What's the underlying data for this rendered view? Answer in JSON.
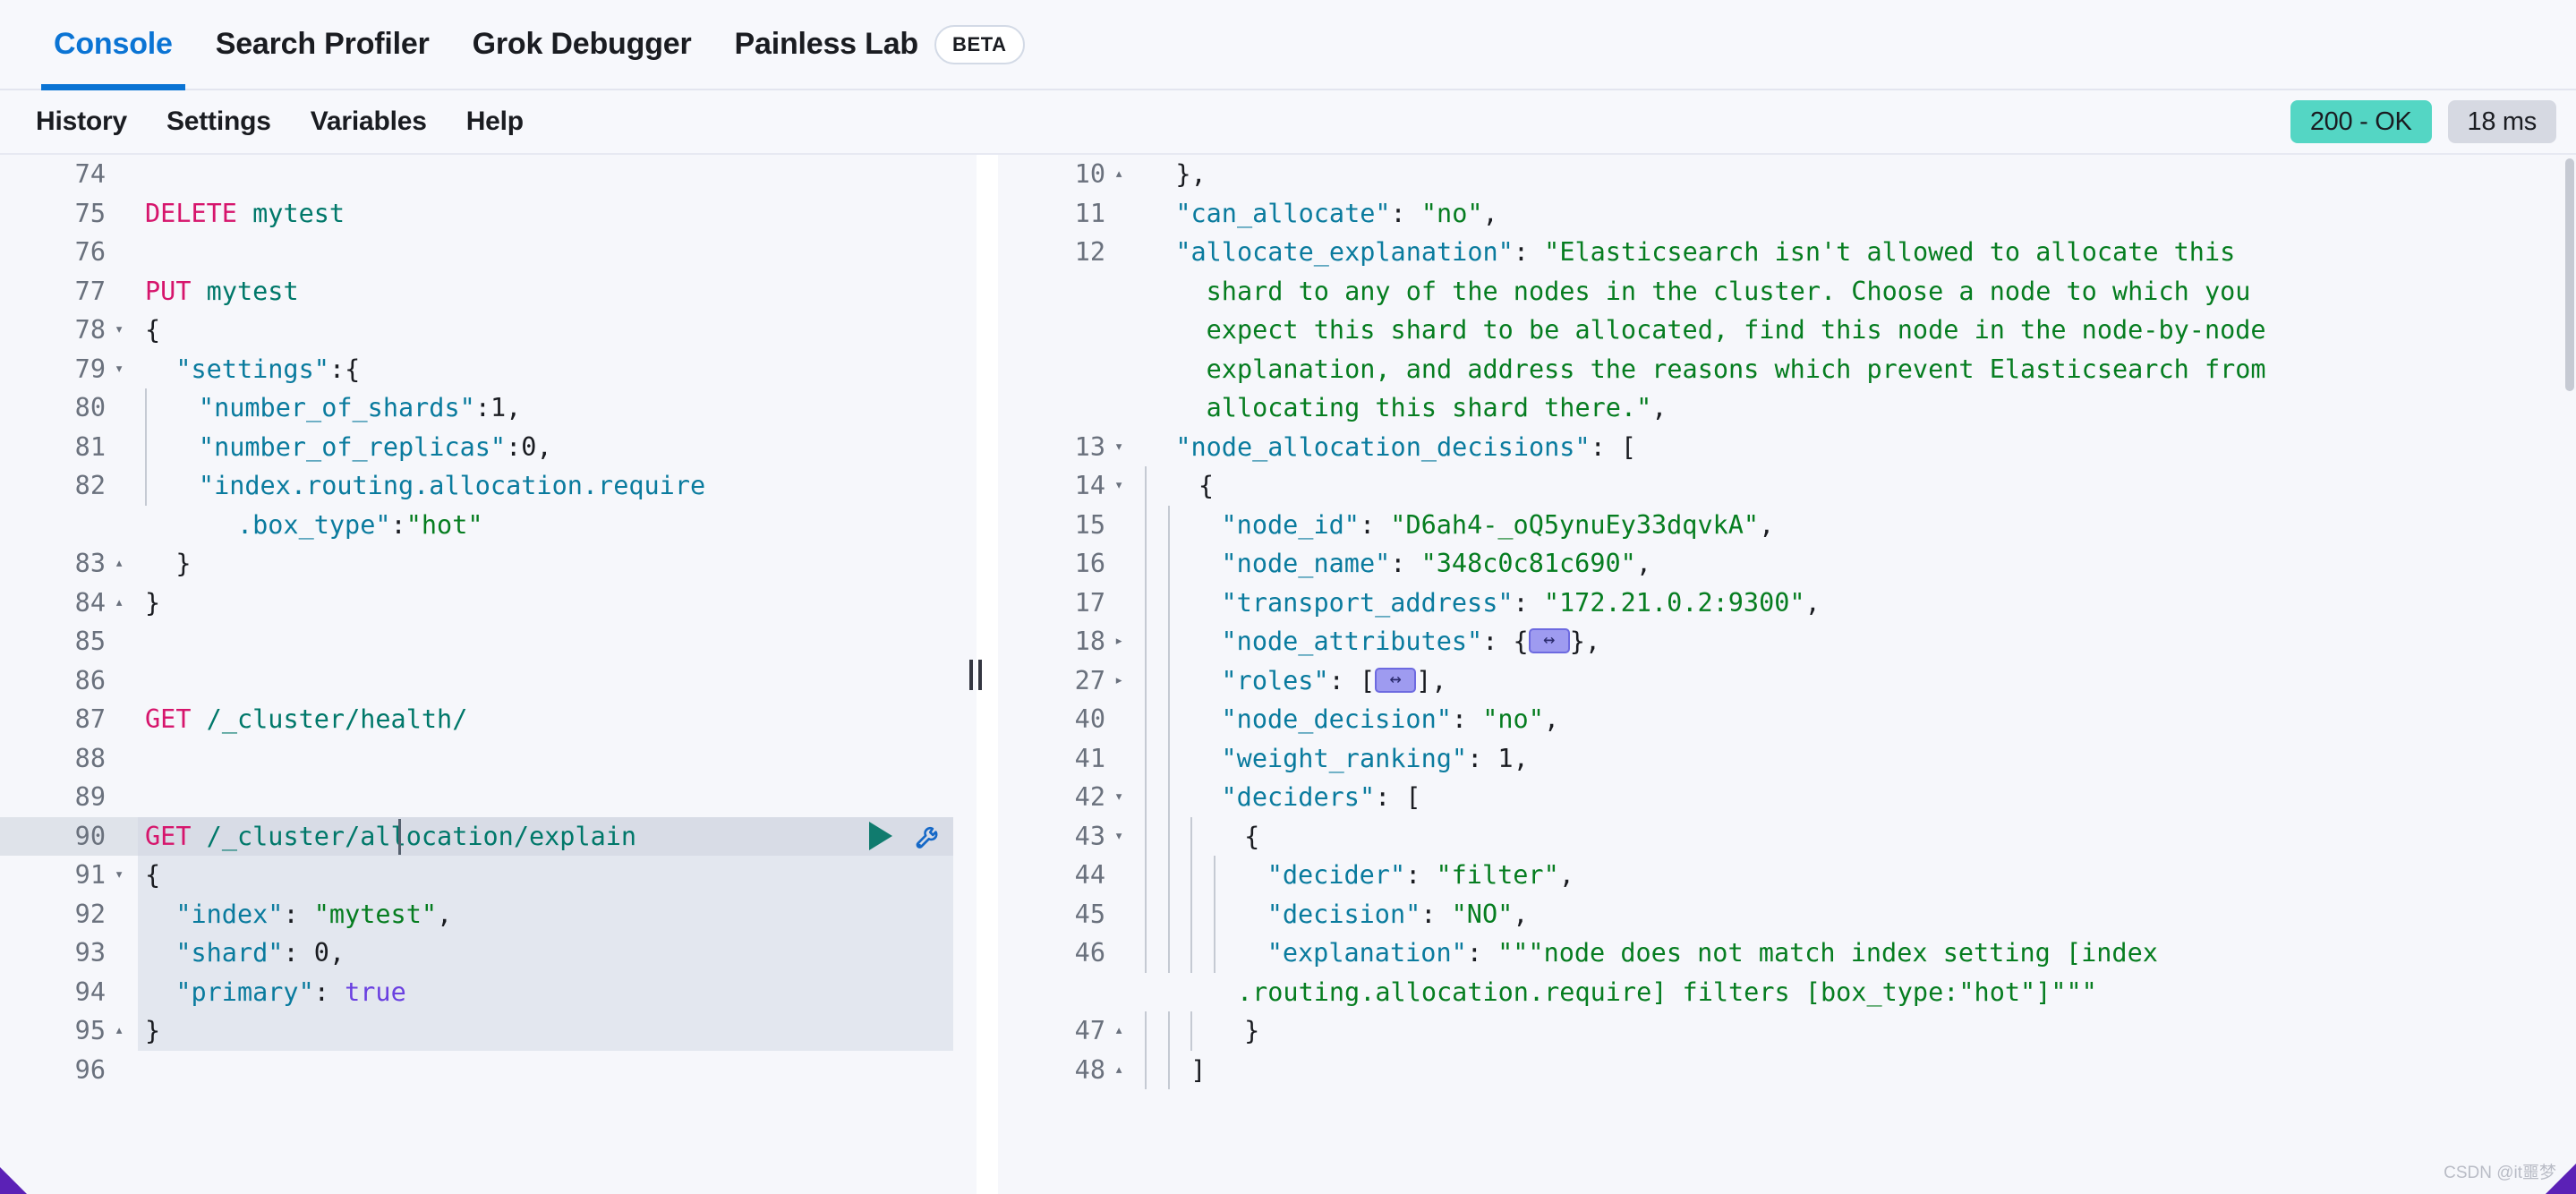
{
  "app": {
    "tabs": [
      {
        "label": "Console",
        "active": true
      },
      {
        "label": "Search Profiler",
        "active": false
      },
      {
        "label": "Grok Debugger",
        "active": false
      },
      {
        "label": "Painless Lab",
        "active": false,
        "badge": "BETA"
      }
    ]
  },
  "toolbar": {
    "history_label": "History",
    "settings_label": "Settings",
    "variables_label": "Variables",
    "help_label": "Help",
    "status_label": "200 - OK",
    "time_label": "18 ms",
    "status_color": "#54d6c4",
    "time_color": "#d6d9e2"
  },
  "editor": {
    "play_icon": "play-icon",
    "wrench_icon": "wrench-icon",
    "lines": [
      {
        "n": "74",
        "fold": "",
        "state": "",
        "indent": 0,
        "tokens": []
      },
      {
        "n": "75",
        "fold": "",
        "state": "",
        "indent": 0,
        "tokens": [
          {
            "t": "DELETE",
            "c": "m-method"
          },
          {
            "t": " ",
            "c": "k-punc"
          },
          {
            "t": "mytest",
            "c": "m-url"
          }
        ]
      },
      {
        "n": "76",
        "fold": "",
        "state": "",
        "indent": 0,
        "tokens": []
      },
      {
        "n": "77",
        "fold": "",
        "state": "",
        "indent": 0,
        "tokens": [
          {
            "t": "PUT",
            "c": "m-method"
          },
          {
            "t": " ",
            "c": "k-punc"
          },
          {
            "t": "mytest",
            "c": "m-url"
          }
        ]
      },
      {
        "n": "78",
        "fold": "down",
        "state": "",
        "indent": 0,
        "tokens": [
          {
            "t": "{",
            "c": "k-punc"
          }
        ]
      },
      {
        "n": "79",
        "fold": "down",
        "state": "",
        "indent": 0,
        "tokens": [
          {
            "t": "  ",
            "c": "k-punc"
          },
          {
            "t": "\"settings\"",
            "c": "k-key"
          },
          {
            "t": ":{",
            "c": "k-punc"
          }
        ]
      },
      {
        "n": "80",
        "fold": "",
        "state": "",
        "indent": 1,
        "tokens": [
          {
            "t": "  ",
            "c": "k-punc"
          },
          {
            "t": "\"number_of_shards\"",
            "c": "k-key"
          },
          {
            "t": ":",
            "c": "k-punc"
          },
          {
            "t": "1",
            "c": "k-num"
          },
          {
            "t": ",",
            "c": "k-punc"
          }
        ]
      },
      {
        "n": "81",
        "fold": "",
        "state": "",
        "indent": 1,
        "tokens": [
          {
            "t": "  ",
            "c": "k-punc"
          },
          {
            "t": "\"number_of_replicas\"",
            "c": "k-key"
          },
          {
            "t": ":",
            "c": "k-punc"
          },
          {
            "t": "0",
            "c": "k-num"
          },
          {
            "t": ",",
            "c": "k-punc"
          }
        ]
      },
      {
        "n": "82",
        "fold": "",
        "state": "",
        "indent": 1,
        "wrap": true,
        "tokens": [
          {
            "t": "  ",
            "c": "k-punc"
          },
          {
            "t": "\"index.routing.allocation.require",
            "c": "k-key"
          },
          {
            "t": "\n      ",
            "c": "k-punc"
          },
          {
            "t": ".box_type\"",
            "c": "k-key"
          },
          {
            "t": ":",
            "c": "k-punc"
          },
          {
            "t": "\"hot\"",
            "c": "k-str"
          }
        ]
      },
      {
        "n": "83",
        "fold": "up",
        "state": "",
        "indent": 0,
        "tokens": [
          {
            "t": "  }",
            "c": "k-punc"
          }
        ]
      },
      {
        "n": "84",
        "fold": "up",
        "state": "",
        "indent": 0,
        "tokens": [
          {
            "t": "}",
            "c": "k-punc"
          }
        ]
      },
      {
        "n": "85",
        "fold": "",
        "state": "",
        "indent": 0,
        "tokens": []
      },
      {
        "n": "86",
        "fold": "",
        "state": "",
        "indent": 0,
        "tokens": []
      },
      {
        "n": "87",
        "fold": "",
        "state": "",
        "indent": 0,
        "tokens": [
          {
            "t": "GET",
            "c": "m-method"
          },
          {
            "t": " ",
            "c": "k-punc"
          },
          {
            "t": "/_cluster/health/",
            "c": "m-url"
          }
        ]
      },
      {
        "n": "88",
        "fold": "",
        "state": "",
        "indent": 0,
        "tokens": []
      },
      {
        "n": "89",
        "fold": "",
        "state": "",
        "indent": 0,
        "tokens": []
      },
      {
        "n": "90",
        "fold": "",
        "state": "active",
        "indent": 0,
        "caret": 283,
        "actions": true,
        "tokens": [
          {
            "t": "GET",
            "c": "m-method"
          },
          {
            "t": " ",
            "c": "k-punc"
          },
          {
            "t": "/_cluster/allocation/explain",
            "c": "m-url"
          }
        ]
      },
      {
        "n": "91",
        "fold": "down",
        "state": "sel",
        "indent": 0,
        "tokens": [
          {
            "t": "{",
            "c": "k-punc"
          }
        ]
      },
      {
        "n": "92",
        "fold": "",
        "state": "sel",
        "indent": 0,
        "tokens": [
          {
            "t": "  ",
            "c": "k-punc"
          },
          {
            "t": "\"index\"",
            "c": "k-key"
          },
          {
            "t": ": ",
            "c": "k-punc"
          },
          {
            "t": "\"mytest\"",
            "c": "k-str"
          },
          {
            "t": ",",
            "c": "k-punc"
          }
        ]
      },
      {
        "n": "93",
        "fold": "",
        "state": "sel",
        "indent": 0,
        "tokens": [
          {
            "t": "  ",
            "c": "k-punc"
          },
          {
            "t": "\"shard\"",
            "c": "k-key"
          },
          {
            "t": ": ",
            "c": "k-punc"
          },
          {
            "t": "0",
            "c": "k-num"
          },
          {
            "t": ",",
            "c": "k-punc"
          }
        ]
      },
      {
        "n": "94",
        "fold": "",
        "state": "sel",
        "indent": 0,
        "tokens": [
          {
            "t": "  ",
            "c": "k-punc"
          },
          {
            "t": "\"primary\"",
            "c": "k-key"
          },
          {
            "t": ": ",
            "c": "k-punc"
          },
          {
            "t": "true",
            "c": "k-bool"
          }
        ]
      },
      {
        "n": "95",
        "fold": "up",
        "state": "sel",
        "indent": 0,
        "tokens": [
          {
            "t": "}",
            "c": "k-punc"
          }
        ]
      },
      {
        "n": "96",
        "fold": "",
        "state": "",
        "indent": 0,
        "tokens": []
      }
    ]
  },
  "response": {
    "lines": [
      {
        "n": "10",
        "fold": "up",
        "indent": 0,
        "tokens": [
          {
            "t": "  },",
            "c": "k-punc"
          }
        ]
      },
      {
        "n": "11",
        "fold": "",
        "indent": 0,
        "tokens": [
          {
            "t": "  ",
            "c": "k-punc"
          },
          {
            "t": "\"can_allocate\"",
            "c": "k-key"
          },
          {
            "t": ": ",
            "c": "k-punc"
          },
          {
            "t": "\"no\"",
            "c": "k-str"
          },
          {
            "t": ",",
            "c": "k-punc"
          }
        ]
      },
      {
        "n": "12",
        "fold": "",
        "indent": 0,
        "wrap": true,
        "tokens": [
          {
            "t": "  ",
            "c": "k-punc"
          },
          {
            "t": "\"allocate_explanation\"",
            "c": "k-key"
          },
          {
            "t": ": ",
            "c": "k-punc"
          },
          {
            "t": "\"Elasticsearch isn't allowed to allocate this\n    shard to any of the nodes in the cluster. Choose a node to which you\n    expect this shard to be allocated, find this node in the node-by-node\n    explanation, and address the reasons which prevent Elasticsearch from\n    allocating this shard there.\"",
            "c": "k-str"
          },
          {
            "t": ",",
            "c": "k-punc"
          }
        ]
      },
      {
        "n": "13",
        "fold": "down",
        "indent": 0,
        "tokens": [
          {
            "t": "  ",
            "c": "k-punc"
          },
          {
            "t": "\"node_allocation_decisions\"",
            "c": "k-key"
          },
          {
            "t": ": [",
            "c": "k-punc"
          }
        ]
      },
      {
        "n": "14",
        "fold": "down",
        "indent": 1,
        "tokens": [
          {
            "t": "  {",
            "c": "k-punc"
          }
        ]
      },
      {
        "n": "15",
        "fold": "",
        "indent": 2,
        "tokens": [
          {
            "t": "  ",
            "c": "k-punc"
          },
          {
            "t": "\"node_id\"",
            "c": "k-key"
          },
          {
            "t": ": ",
            "c": "k-punc"
          },
          {
            "t": "\"D6ah4-_oQ5ynuEy33dqvkA\"",
            "c": "k-str"
          },
          {
            "t": ",",
            "c": "k-punc"
          }
        ]
      },
      {
        "n": "16",
        "fold": "",
        "indent": 2,
        "tokens": [
          {
            "t": "  ",
            "c": "k-punc"
          },
          {
            "t": "\"node_name\"",
            "c": "k-key"
          },
          {
            "t": ": ",
            "c": "k-punc"
          },
          {
            "t": "\"348c0c81c690\"",
            "c": "k-str"
          },
          {
            "t": ",",
            "c": "k-punc"
          }
        ]
      },
      {
        "n": "17",
        "fold": "",
        "indent": 2,
        "tokens": [
          {
            "t": "  ",
            "c": "k-punc"
          },
          {
            "t": "\"transport_address\"",
            "c": "k-key"
          },
          {
            "t": ": ",
            "c": "k-punc"
          },
          {
            "t": "\"172.21.0.2:9300\"",
            "c": "k-str"
          },
          {
            "t": ",",
            "c": "k-punc"
          }
        ]
      },
      {
        "n": "18",
        "fold": "right",
        "indent": 2,
        "tokens": [
          {
            "t": "  ",
            "c": "k-punc"
          },
          {
            "t": "\"node_attributes\"",
            "c": "k-key"
          },
          {
            "t": ": {",
            "c": "k-punc"
          },
          {
            "t": "",
            "c": "folded-widget"
          },
          {
            "t": "},",
            "c": "k-punc"
          }
        ]
      },
      {
        "n": "27",
        "fold": "right",
        "indent": 2,
        "tokens": [
          {
            "t": "  ",
            "c": "k-punc"
          },
          {
            "t": "\"roles\"",
            "c": "k-key"
          },
          {
            "t": ": [",
            "c": "k-punc"
          },
          {
            "t": "",
            "c": "folded-widget"
          },
          {
            "t": "],",
            "c": "k-punc"
          }
        ]
      },
      {
        "n": "40",
        "fold": "",
        "indent": 2,
        "tokens": [
          {
            "t": "  ",
            "c": "k-punc"
          },
          {
            "t": "\"node_decision\"",
            "c": "k-key"
          },
          {
            "t": ": ",
            "c": "k-punc"
          },
          {
            "t": "\"no\"",
            "c": "k-str"
          },
          {
            "t": ",",
            "c": "k-punc"
          }
        ]
      },
      {
        "n": "41",
        "fold": "",
        "indent": 2,
        "tokens": [
          {
            "t": "  ",
            "c": "k-punc"
          },
          {
            "t": "\"weight_ranking\"",
            "c": "k-key"
          },
          {
            "t": ": ",
            "c": "k-punc"
          },
          {
            "t": "1",
            "c": "k-num"
          },
          {
            "t": ",",
            "c": "k-punc"
          }
        ]
      },
      {
        "n": "42",
        "fold": "down",
        "indent": 2,
        "tokens": [
          {
            "t": "  ",
            "c": "k-punc"
          },
          {
            "t": "\"deciders\"",
            "c": "k-key"
          },
          {
            "t": ": [",
            "c": "k-punc"
          }
        ]
      },
      {
        "n": "43",
        "fold": "down",
        "indent": 3,
        "tokens": [
          {
            "t": "  {",
            "c": "k-punc"
          }
        ]
      },
      {
        "n": "44",
        "fold": "",
        "indent": 4,
        "tokens": [
          {
            "t": "  ",
            "c": "k-punc"
          },
          {
            "t": "\"decider\"",
            "c": "k-key"
          },
          {
            "t": ": ",
            "c": "k-punc"
          },
          {
            "t": "\"filter\"",
            "c": "k-str"
          },
          {
            "t": ",",
            "c": "k-punc"
          }
        ]
      },
      {
        "n": "45",
        "fold": "",
        "indent": 4,
        "tokens": [
          {
            "t": "  ",
            "c": "k-punc"
          },
          {
            "t": "\"decision\"",
            "c": "k-key"
          },
          {
            "t": ": ",
            "c": "k-punc"
          },
          {
            "t": "\"NO\"",
            "c": "k-str"
          },
          {
            "t": ",",
            "c": "k-punc"
          }
        ]
      },
      {
        "n": "46",
        "fold": "",
        "indent": 4,
        "wrap": true,
        "tokens": [
          {
            "t": "  ",
            "c": "k-punc"
          },
          {
            "t": "\"explanation\"",
            "c": "k-key"
          },
          {
            "t": ": ",
            "c": "k-punc"
          },
          {
            "t": "\"\"\"node does not match index setting [index\n      .routing.allocation.require] filters [box_type:\"hot\"]\"\"\"",
            "c": "k-str"
          }
        ]
      },
      {
        "n": "47",
        "fold": "up",
        "indent": 3,
        "tokens": [
          {
            "t": "  }",
            "c": "k-punc"
          }
        ]
      },
      {
        "n": "48",
        "fold": "up",
        "indent": 2,
        "tokens": [
          {
            "t": "]",
            "c": "k-punc"
          }
        ]
      }
    ]
  },
  "watermark": {
    "text": "CSDN @it噩梦"
  }
}
